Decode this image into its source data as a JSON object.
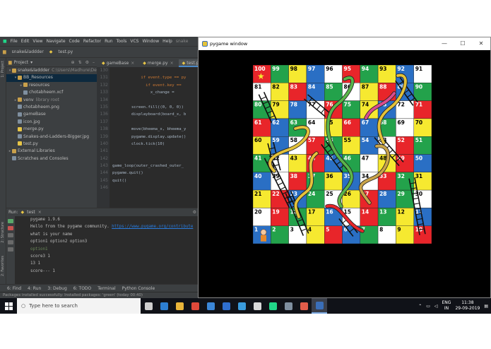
{
  "ide": {
    "project_name": "snake&laddder",
    "file_crumb": "test.py",
    "menu": [
      "File",
      "Edit",
      "View",
      "Navigate",
      "Code",
      "Refactor",
      "Run",
      "Tools",
      "VCS",
      "Window",
      "Help"
    ],
    "title_suffix": "snake",
    "project_panel": {
      "header": "Project",
      "tree": [
        {
          "label": "snake&laddder",
          "extra": "C:\\Users\\Madhure\\De",
          "level": 0,
          "type": "folder",
          "open": true
        },
        {
          "label": "BB_Resources",
          "level": 1,
          "type": "folder",
          "open": true,
          "selected": true
        },
        {
          "label": "resources",
          "level": 2,
          "type": "folder",
          "open": false
        },
        {
          "label": "chotabheem.xcf",
          "level": 2,
          "type": "file"
        },
        {
          "label": "venv",
          "extra": "library root",
          "level": 1,
          "type": "folder",
          "open": false
        },
        {
          "label": "chotabheem.png",
          "level": 1,
          "type": "file"
        },
        {
          "label": "gameBase",
          "level": 1,
          "type": "file"
        },
        {
          "label": "icon.jpg",
          "level": 1,
          "type": "file"
        },
        {
          "label": "merge.py",
          "level": 1,
          "type": "file"
        },
        {
          "label": "Snakes-and-Ladders-Bigger.jpg",
          "level": 1,
          "type": "file"
        },
        {
          "label": "test.py",
          "level": 1,
          "type": "file"
        },
        {
          "label": "External Libraries",
          "level": 0,
          "type": "folder",
          "open": false
        },
        {
          "label": "Scratches and Consoles",
          "level": 0,
          "type": "file"
        }
      ]
    },
    "tabs": [
      "gameBase",
      "merge.py",
      "test.py"
    ],
    "active_tab": "test.py",
    "code_lines": [
      {
        "n": "130",
        "t": ""
      },
      {
        "n": "131",
        "t": "            if event.type == py"
      },
      {
        "n": "132",
        "t": "              if event.key =="
      },
      {
        "n": "133",
        "t": "                x_change ="
      },
      {
        "n": "134",
        "t": ""
      },
      {
        "n": "135",
        "t": "        screen.fill((0, 0, 0))"
      },
      {
        "n": "136",
        "t": "        displayboard(board_x, b"
      },
      {
        "n": "137",
        "t": ""
      },
      {
        "n": "138",
        "t": "        move(bheema_x, bheema_y"
      },
      {
        "n": "139",
        "t": "        pygame.display.update()"
      },
      {
        "n": "140",
        "t": "        clock.tick(10)"
      },
      {
        "n": "141",
        "t": ""
      },
      {
        "n": "142",
        "t": ""
      },
      {
        "n": "143",
        "t": "game_loop(outer_crashed_outer_"
      },
      {
        "n": "144",
        "t": "pygame.quit()"
      },
      {
        "n": "145",
        "t": "quit()"
      },
      {
        "n": "146",
        "t": ""
      }
    ],
    "run": {
      "header": "Run:",
      "config": "test",
      "console": [
        {
          "t": "pygame 1.9.6",
          "c": ""
        },
        {
          "t": "Hello from the pygame community. ",
          "link": "https://www.pygame.org/contribute",
          "c": ""
        },
        {
          "t": "what is your name",
          "c": ""
        },
        {
          "t": "option1 option2 option3",
          "c": ""
        },
        {
          "t": "option1",
          "c": "green"
        },
        {
          "t": "score3 1",
          "c": ""
        },
        {
          "t": "13 1",
          "c": ""
        },
        {
          "t": "score--- 1",
          "c": ""
        }
      ]
    },
    "bottom_tabs": [
      "6: Find",
      "4: Run",
      "3: Debug",
      "6: TODO",
      "Terminal",
      "Python Console"
    ],
    "status": "Packages installed successfully: Installed packages: 'green' (today 00:40)",
    "side_tabs": [
      "1: Project",
      "2: Structure",
      "2: Favorites"
    ]
  },
  "pygame": {
    "title": "pygame window",
    "controls": [
      "minimize",
      "maximize",
      "close"
    ],
    "board": {
      "rows": [
        [
          100,
          99,
          98,
          97,
          96,
          95,
          94,
          93,
          92,
          91
        ],
        [
          81,
          82,
          83,
          84,
          85,
          86,
          87,
          88,
          89,
          90
        ],
        [
          80,
          79,
          78,
          77,
          76,
          75,
          74,
          73,
          72,
          71
        ],
        [
          61,
          62,
          63,
          64,
          65,
          66,
          67,
          68,
          69,
          70
        ],
        [
          60,
          59,
          58,
          57,
          56,
          55,
          54,
          53,
          52,
          51
        ],
        [
          41,
          42,
          43,
          44,
          45,
          46,
          47,
          48,
          49,
          50
        ],
        [
          40,
          39,
          38,
          37,
          36,
          35,
          34,
          33,
          32,
          31
        ],
        [
          21,
          22,
          23,
          24,
          25,
          26,
          27,
          28,
          29,
          30
        ],
        [
          20,
          19,
          18,
          17,
          16,
          15,
          14,
          13,
          12,
          11
        ],
        [
          1,
          2,
          3,
          4,
          5,
          6,
          7,
          8,
          9,
          10
        ]
      ],
      "palette": [
        "#e8252a",
        "#23a24b",
        "#f6e930",
        "#2a6fc4",
        "#ffffff"
      ],
      "player_at": 1,
      "star_at": 100
    }
  },
  "taskbar": {
    "search_placeholder": "Type here to search",
    "apps": [
      "task-view",
      "edge",
      "files",
      "chrome",
      "store",
      "mail",
      "photos",
      "cards",
      "pycharm",
      "tools",
      "paint",
      "python"
    ],
    "lang_top": "ENG",
    "lang_bottom": "IN",
    "time": "11:38",
    "date": "29-09-2019"
  }
}
